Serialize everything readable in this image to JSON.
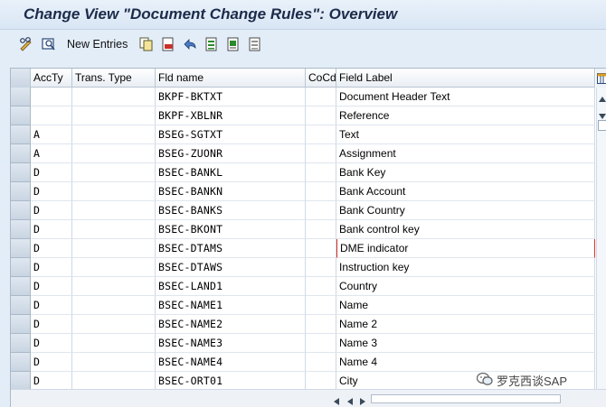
{
  "title": "Change View \"Document Change Rules\": Overview",
  "toolbar": {
    "new_entries_label": "New Entries",
    "icons": [
      "pencil-glasses-icon",
      "display-change-icon",
      "copy-icon",
      "delete-icon",
      "undo-icon",
      "select-all-icon",
      "select-block-icon",
      "deselect-all-icon"
    ]
  },
  "table": {
    "columns": [
      "AccTy",
      "Trans. Type",
      "Fld name",
      "CoCd",
      "Field Label"
    ],
    "rows": [
      {
        "accty": "",
        "trans_type": "",
        "fld_name": "BKPF-BKTXT",
        "cocd": "",
        "label": "Document Header Text"
      },
      {
        "accty": "",
        "trans_type": "",
        "fld_name": "BKPF-XBLNR",
        "cocd": "",
        "label": "Reference"
      },
      {
        "accty": "A",
        "trans_type": "",
        "fld_name": "BSEG-SGTXT",
        "cocd": "",
        "label": "Text"
      },
      {
        "accty": "A",
        "trans_type": "",
        "fld_name": "BSEG-ZUONR",
        "cocd": "",
        "label": "Assignment"
      },
      {
        "accty": "D",
        "trans_type": "",
        "fld_name": "BSEC-BANKL",
        "cocd": "",
        "label": "Bank Key"
      },
      {
        "accty": "D",
        "trans_type": "",
        "fld_name": "BSEC-BANKN",
        "cocd": "",
        "label": "Bank Account"
      },
      {
        "accty": "D",
        "trans_type": "",
        "fld_name": "BSEC-BANKS",
        "cocd": "",
        "label": "Bank Country"
      },
      {
        "accty": "D",
        "trans_type": "",
        "fld_name": "BSEC-BKONT",
        "cocd": "",
        "label": "Bank control key"
      },
      {
        "accty": "D",
        "trans_type": "",
        "fld_name": "BSEC-DTAMS",
        "cocd": "",
        "label": "DME indicator"
      },
      {
        "accty": "D",
        "trans_type": "",
        "fld_name": "BSEC-DTAWS",
        "cocd": "",
        "label": "Instruction key"
      },
      {
        "accty": "D",
        "trans_type": "",
        "fld_name": "BSEC-LAND1",
        "cocd": "",
        "label": "Country"
      },
      {
        "accty": "D",
        "trans_type": "",
        "fld_name": "BSEC-NAME1",
        "cocd": "",
        "label": "Name"
      },
      {
        "accty": "D",
        "trans_type": "",
        "fld_name": "BSEC-NAME2",
        "cocd": "",
        "label": "Name 2"
      },
      {
        "accty": "D",
        "trans_type": "",
        "fld_name": "BSEC-NAME3",
        "cocd": "",
        "label": "Name 3"
      },
      {
        "accty": "D",
        "trans_type": "",
        "fld_name": "BSEC-NAME4",
        "cocd": "",
        "label": "Name 4"
      },
      {
        "accty": "D",
        "trans_type": "",
        "fld_name": "BSEC-ORT01",
        "cocd": "",
        "label": "City"
      }
    ]
  },
  "watermark": "罗克西谈SAP",
  "colors": {
    "focus_bracket": "#d9342b",
    "title": "#1c2b4a"
  }
}
